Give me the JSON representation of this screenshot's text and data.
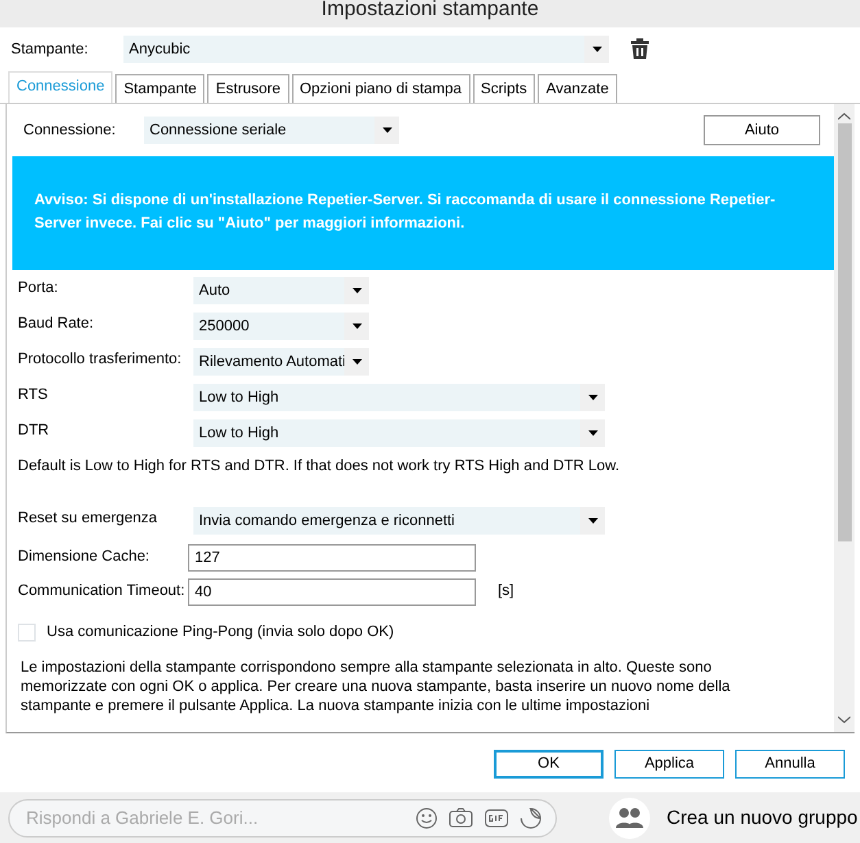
{
  "window": {
    "title": "Impostazioni stampante"
  },
  "printer": {
    "label": "Stampante:",
    "value": "Anycubic"
  },
  "tabs": [
    {
      "label": "Connessione",
      "selected": true
    },
    {
      "label": "Stampante",
      "selected": false
    },
    {
      "label": "Estrusore",
      "selected": false
    },
    {
      "label": "Opzioni piano di stampa",
      "selected": false
    },
    {
      "label": "Scripts",
      "selected": false
    },
    {
      "label": "Avanzate",
      "selected": false
    }
  ],
  "connection": {
    "label": "Connessione:",
    "value": "Connessione seriale",
    "help_button": "Aiuto"
  },
  "notice": "Avviso: Si dispone di un'installazione Repetier-Server. Si raccomanda di usare il connessione Repetier-Server invece. Fai clic su \"Aiuto\" per maggiori informazioni.",
  "settings": [
    {
      "kind": "select",
      "label": "Porta:",
      "value": "Auto"
    },
    {
      "kind": "select",
      "label": "Baud Rate:",
      "value": "250000"
    },
    {
      "kind": "select",
      "label": "Protocollo trasferimento:",
      "value": "Rilevamento Automati"
    },
    {
      "kind": "wide_select",
      "label": "RTS",
      "value": "Low to High"
    },
    {
      "kind": "wide_select",
      "label": "DTR",
      "value": "Low to High"
    },
    {
      "kind": "note",
      "label": "Default is Low to High for RTS and DTR. If that does not work try RTS High and DTR Low."
    },
    {
      "kind": "wide_select",
      "label": "Reset su emergenza",
      "value": "Invia comando emergenza e riconnetti"
    },
    {
      "kind": "input",
      "label": "Dimensione Cache:",
      "value": "127"
    },
    {
      "kind": "input",
      "label": "Communication Timeout:",
      "value": "40",
      "unit": "[s]"
    },
    {
      "kind": "checkbox",
      "label": "Usa comunicazione Ping-Pong (invia solo dopo OK)",
      "checked": false
    }
  ],
  "info_text": "Le impostazioni della stampante corrispondono sempre alla stampante selezionata in alto. Queste sono memorizzate con ogni OK o applica. Per creare una nuova stampante, basta inserire un nuovo nome della stampante e premere il pulsante Applica. La nuova stampante inizia con le ultime impostazioni",
  "buttons": [
    {
      "label": "OK",
      "default": true
    },
    {
      "label": "Applica",
      "default": false
    },
    {
      "label": "Annulla",
      "default": false
    }
  ],
  "chat_bar": {
    "placeholder": "Rispondi a Gabriele E. Gori...",
    "new_group": "Crea un nuovo gruppo"
  }
}
